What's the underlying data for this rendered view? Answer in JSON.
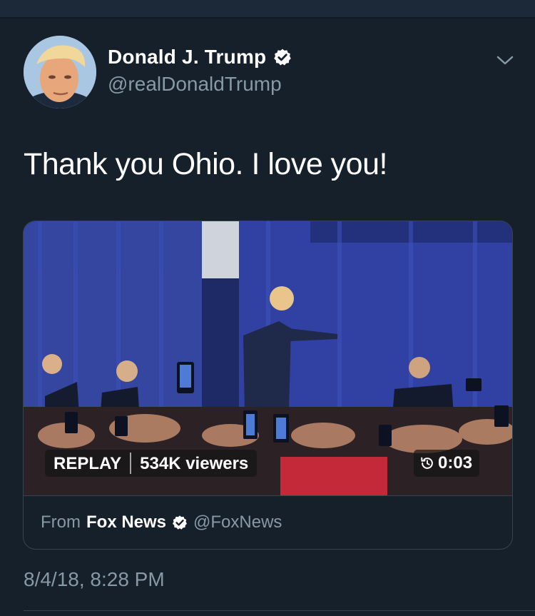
{
  "tweet": {
    "display_name": "Donald J. Trump",
    "handle": "@realDonaldTrump",
    "text": "Thank you Ohio. I love you!",
    "timestamp": "8/4/18, 8:28 PM"
  },
  "video": {
    "replay_label": "REPLAY",
    "viewers": "534K viewers",
    "duration": "0:03"
  },
  "source": {
    "from_label": "From",
    "name": "Fox News",
    "handle": "@FoxNews"
  },
  "colors": {
    "background": "#15202b",
    "secondary_text": "#8899a6",
    "verified_badge": "#ffffff"
  },
  "icons": [
    "verified-icon",
    "chevron-down-icon",
    "clock-replay-icon"
  ]
}
